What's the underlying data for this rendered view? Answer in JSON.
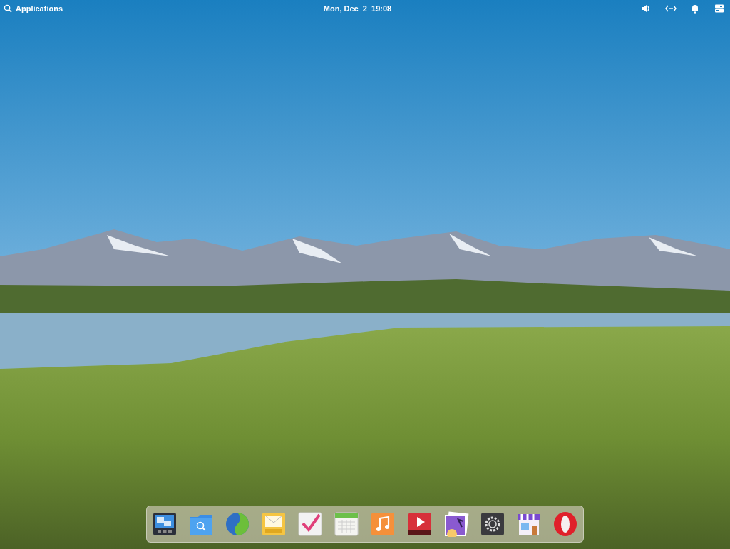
{
  "panel": {
    "applications_label": "Applications",
    "clock": "Mon, Dec  2  19:08",
    "indicators": [
      {
        "kind": "sound"
      },
      {
        "kind": "network"
      },
      {
        "kind": "notifications"
      },
      {
        "kind": "session"
      }
    ]
  },
  "dock": [
    {
      "kind": "multitasking"
    },
    {
      "kind": "files"
    },
    {
      "kind": "browser"
    },
    {
      "kind": "mail"
    },
    {
      "kind": "tasks"
    },
    {
      "kind": "calendar"
    },
    {
      "kind": "music"
    },
    {
      "kind": "videos"
    },
    {
      "kind": "photos"
    },
    {
      "kind": "settings"
    },
    {
      "kind": "store"
    },
    {
      "kind": "opera"
    }
  ]
}
